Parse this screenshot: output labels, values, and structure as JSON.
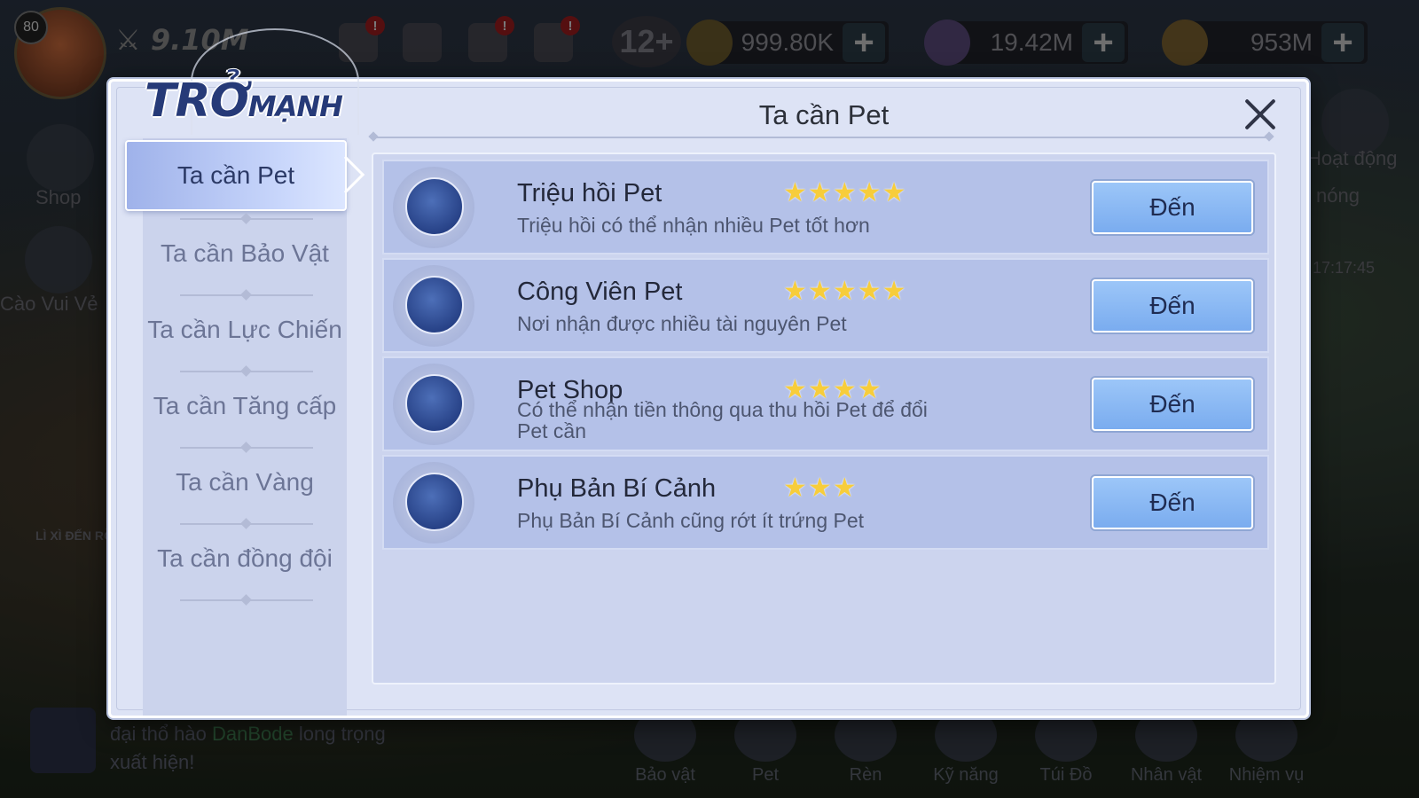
{
  "hud": {
    "level": "80",
    "power": "9.10M",
    "age_rating": "12+",
    "resources": [
      {
        "name": "scroll",
        "value": "999.80K",
        "icon": "scroll-icon",
        "color": "#c9a84a"
      },
      {
        "name": "gem",
        "value": "19.42M",
        "icon": "gem-icon",
        "color": "#9a78d6"
      },
      {
        "name": "gold",
        "value": "953M",
        "icon": "gold-coin-icon",
        "color": "#d8a43a"
      }
    ],
    "plus_label": "+",
    "notification_mark": "!"
  },
  "side": {
    "shop_label": "Shop",
    "event_label": "Cào Vui Vẻ",
    "lixi_label": "LÌ XÌ ĐẾN RỒI",
    "activity_label": "Hoạt động",
    "hot_label": "nóng",
    "timer": "17:17:45"
  },
  "chat": {
    "prefix": "đại thổ hào",
    "name": "DanBode",
    "suffix": "long trọng xuất hiện!"
  },
  "bottom_nav": [
    "Bảo vật",
    "Pet",
    "Rèn",
    "Kỹ năng",
    "Túi Đồ",
    "Nhân vật",
    "Nhiệm vụ"
  ],
  "dialog": {
    "logo_big": "TRỞ",
    "logo_small": "MẠNH",
    "title": "Ta cần Pet",
    "tabs": [
      {
        "label": "Ta cần Pet",
        "active": true
      },
      {
        "label": "Ta cần Bảo Vật",
        "active": false
      },
      {
        "label": "Ta cần Lực Chiến",
        "active": false
      },
      {
        "label": "Ta cần Tăng cấp",
        "active": false
      },
      {
        "label": "Ta cần Vàng",
        "active": false
      },
      {
        "label": "Ta cần đồng đội",
        "active": false
      }
    ],
    "rows": [
      {
        "title": "Triệu hồi Pet",
        "desc": "Triệu hồi có thể nhận nhiều Pet tốt hơn",
        "stars": 5,
        "button": "Đến"
      },
      {
        "title": "Công Viên Pet",
        "desc": "Nơi nhận được nhiều tài nguyên Pet",
        "stars": 5,
        "button": "Đến"
      },
      {
        "title": "Pet Shop",
        "desc": "Có thể nhận tiền thông qua thu hồi Pet để đổi Pet cần",
        "stars": 4,
        "button": "Đến"
      },
      {
        "title": "Phụ Bản Bí Cảnh",
        "desc": "Phụ Bản Bí Cảnh cũng rớt ít trứng Pet",
        "stars": 3,
        "button": "Đến"
      }
    ]
  },
  "colors": {
    "dialog_bg": "#dde3f5",
    "row_bg": "#b4c1e8",
    "button_bg": "#7aacef",
    "star": "#f7cd3b",
    "logo": "#263a78"
  }
}
